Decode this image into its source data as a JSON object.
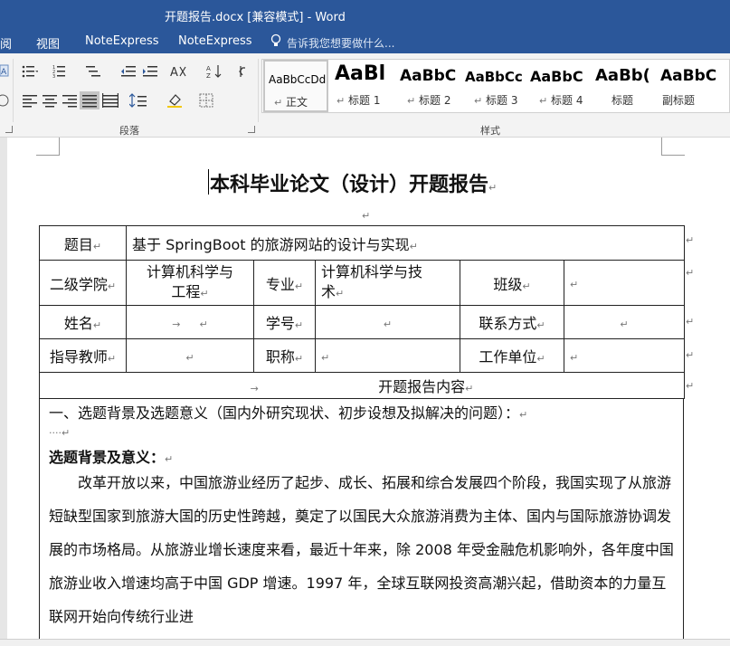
{
  "window": {
    "title": "开题报告.docx [兼容模式] - Word"
  },
  "menu": {
    "items": [
      "阅",
      "视图",
      "NoteExpress",
      "NoteExpress"
    ],
    "tell_me": "告诉我您想要做什么..."
  },
  "ribbon": {
    "groups": {
      "paragraph": "段落",
      "styles": "样式"
    },
    "styles": [
      {
        "sample": "AaBbCcDd",
        "name": "正文"
      },
      {
        "sample": "AaBl",
        "name": "标题 1"
      },
      {
        "sample": "AaBbC",
        "name": "标题 2"
      },
      {
        "sample": "AaBbCc",
        "name": "标题 3"
      },
      {
        "sample": "AaBbC",
        "name": "标题 4"
      },
      {
        "sample": "AaBb(",
        "name": "标题"
      },
      {
        "sample": "AaBbC",
        "name": "副标题"
      }
    ]
  },
  "document": {
    "title": "本科毕业论文（设计）开题报告",
    "table": {
      "topic_label": "题目",
      "topic_value": "基于 SpringBoot 的旅游网站的设计与实现",
      "college_label": "二级学院",
      "college_value_1": "计算机科学与",
      "college_value_2": "工程",
      "major_label": "专业",
      "major_value_1": "计算机科学与技",
      "major_value_2": "术",
      "class_label": "班级",
      "name_label": "姓名",
      "id_label": "学号",
      "contact_label": "联系方式",
      "advisor_label": "指导教师",
      "rank_label": "职称",
      "unit_label": "工作单位",
      "content_header": "开题报告内容"
    },
    "section_heading": "一、选题背景及选题意义（国内外研究现状、初步设想及拟解决的问题）：",
    "sub_heading": "选题背景及意义：",
    "paragraph": "改革开放以来，中国旅游业经历了起步、成长、拓展和综合发展四个阶段，我国实现了从旅游短缺型国家到旅游大国的历史性跨越，奠定了以国民大众旅游消费为主体、国内与国际旅游协调发展的市场格局。从旅游业增长速度来看，最近十年来，除 2008 年受金融危机影响外，各年度中国旅游业收入增速均高于中国 GDP 增速。1997 年，全球互联网投资高潮兴起，借助资本的力量互联网开始向传统行业进"
  },
  "colors": {
    "word_blue": "#2b579a",
    "ribbon_bg": "#f3f3f3",
    "doc_bg": "#e6e6e6"
  }
}
